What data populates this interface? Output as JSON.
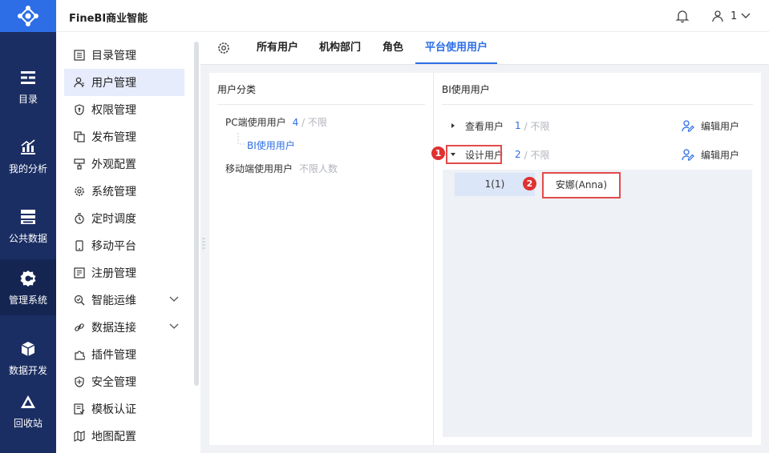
{
  "app": {
    "title": "FineBI商业智能"
  },
  "header": {
    "user_label": "1"
  },
  "rail": {
    "items": [
      {
        "label": "目录",
        "icon": "catalog-icon"
      },
      {
        "label": "我的分析",
        "icon": "analysis-icon"
      },
      {
        "label": "公共数据",
        "icon": "public-data-icon"
      },
      {
        "label": "管理系统",
        "icon": "management-icon",
        "active": true
      },
      {
        "label": "数据开发",
        "icon": "data-dev-icon"
      },
      {
        "label": "回收站",
        "icon": "recycle-bin-icon"
      }
    ]
  },
  "menu": {
    "items": [
      {
        "label": "目录管理",
        "icon": "list-icon"
      },
      {
        "label": "用户管理",
        "icon": "user-icon",
        "active": true
      },
      {
        "label": "权限管理",
        "icon": "permission-icon"
      },
      {
        "label": "发布管理",
        "icon": "publish-icon"
      },
      {
        "label": "外观配置",
        "icon": "appearance-icon"
      },
      {
        "label": "系统管理",
        "icon": "settings-icon"
      },
      {
        "label": "定时调度",
        "icon": "timer-icon"
      },
      {
        "label": "移动平台",
        "icon": "mobile-icon"
      },
      {
        "label": "注册管理",
        "icon": "register-icon"
      },
      {
        "label": "智能运维",
        "icon": "ops-icon",
        "expandable": true
      },
      {
        "label": "数据连接",
        "icon": "link-icon",
        "expandable": true
      },
      {
        "label": "插件管理",
        "icon": "plugin-icon"
      },
      {
        "label": "安全管理",
        "icon": "shield-icon"
      },
      {
        "label": "模板认证",
        "icon": "template-icon"
      },
      {
        "label": "地图配置",
        "icon": "map-icon"
      }
    ]
  },
  "tabs": [
    {
      "label": "所有用户"
    },
    {
      "label": "机构部门"
    },
    {
      "label": "角色"
    },
    {
      "label": "平台使用用户",
      "active": true
    }
  ],
  "left_panel": {
    "title": "用户分类",
    "categories": [
      {
        "label": "PC端使用用户",
        "count": "4",
        "limit": "/ 不限"
      },
      {
        "label": "BI使用用户"
      },
      {
        "label": "移动端使用用户",
        "limit": "不限人数"
      }
    ]
  },
  "right_panel": {
    "title": "BI使用用户",
    "groups": [
      {
        "label": "查看用户",
        "count": "1",
        "limit": "/ 不限",
        "action": "编辑用户",
        "expanded": false
      },
      {
        "label": "设计用户",
        "count": "2",
        "limit": "/ 不限",
        "action": "编辑用户",
        "expanded": true
      }
    ],
    "member_count": "1(1)",
    "member_name": "安娜(Anna)"
  },
  "markers": [
    "1",
    "2"
  ],
  "colors": {
    "accent": "#2d6ee6",
    "rail": "#1b2e63",
    "highlight": "#e34a4a"
  }
}
